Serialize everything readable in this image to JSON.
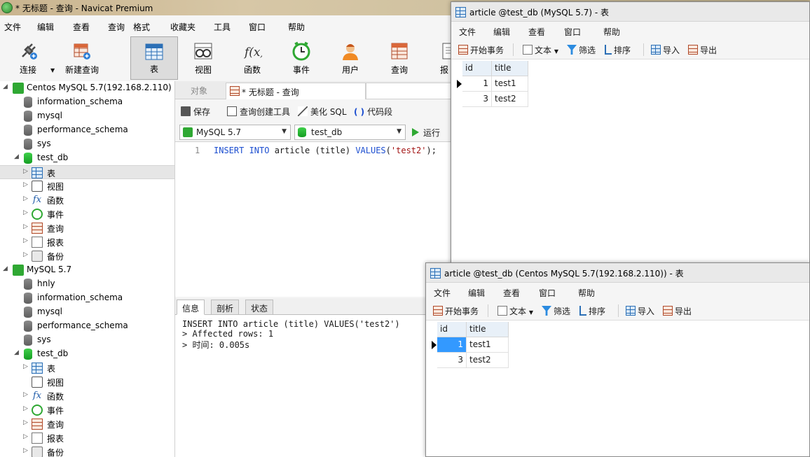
{
  "main": {
    "title": "* 无标题 - 查询 - Navicat Premium",
    "menu": [
      "文件",
      "编辑",
      "查看",
      "查询",
      "格式",
      "收藏夹",
      "工具",
      "窗口",
      "帮助"
    ],
    "toolbar": [
      {
        "label": "连接",
        "icon": "plug-icon"
      },
      {
        "label": "新建查询",
        "icon": "new-query-icon"
      },
      {
        "label": "表",
        "icon": "table-icon"
      },
      {
        "label": "视图",
        "icon": "view-icon"
      },
      {
        "label": "函数",
        "icon": "function-icon"
      },
      {
        "label": "事件",
        "icon": "clock-icon"
      },
      {
        "label": "用户",
        "icon": "user-icon"
      },
      {
        "label": "查询",
        "icon": "query-icon"
      },
      {
        "label": "报",
        "icon": "report-icon"
      }
    ]
  },
  "tree": {
    "conn1": {
      "name": "Centos MySQL 5.7(192.168.2.110)",
      "dbs": [
        "information_schema",
        "mysql",
        "performance_schema",
        "sys",
        "test_db"
      ],
      "children": [
        "表",
        "视图",
        "函数",
        "事件",
        "查询",
        "报表",
        "备份"
      ]
    },
    "conn2": {
      "name": "MySQL 5.7",
      "dbs": [
        "hnly",
        "information_schema",
        "mysql",
        "performance_schema",
        "sys",
        "test_db"
      ],
      "children": [
        "表",
        "视图",
        "函数",
        "事件",
        "查询",
        "报表",
        "备份"
      ]
    }
  },
  "tabs": {
    "objects": "对象",
    "query": "* 无标题 - 查询"
  },
  "query_toolbar": {
    "save": "保存",
    "builder": "查询创建工具",
    "beautify": "美化 SQL",
    "snippet": "代码段",
    "connection": "MySQL 5.7",
    "database": "test_db",
    "run": "运行"
  },
  "editor": {
    "line_number": "1",
    "kw1": "INSERT INTO",
    "mid": " article (title) ",
    "kw2": "VALUES",
    "open": "(",
    "str": "'test2'",
    "close": ");"
  },
  "result_tabs": [
    "信息",
    "剖析",
    "状态"
  ],
  "result_lines": [
    "INSERT INTO article (title) VALUES('test2')",
    "> Affected rows: 1",
    "> 时间: 0.005s"
  ],
  "win1": {
    "title": "article @test_db (MySQL 5.7) - 表",
    "menu": [
      "文件",
      "编辑",
      "查看",
      "窗口",
      "帮助"
    ],
    "tools": {
      "begin": "开始事务",
      "text": "文本",
      "filter": "筛选",
      "sort": "排序",
      "import": "导入",
      "export": "导出"
    },
    "columns": [
      "id",
      "title"
    ],
    "rows": [
      [
        "1",
        "test1"
      ],
      [
        "3",
        "test2"
      ]
    ]
  },
  "win2": {
    "title": "article @test_db (Centos MySQL 5.7(192.168.2.110)) - 表",
    "menu": [
      "文件",
      "编辑",
      "查看",
      "窗口",
      "帮助"
    ],
    "tools": {
      "begin": "开始事务",
      "text": "文本",
      "filter": "筛选",
      "sort": "排序",
      "import": "导入",
      "export": "导出"
    },
    "columns": [
      "id",
      "title"
    ],
    "rows": [
      [
        "1",
        "test1"
      ],
      [
        "3",
        "test2"
      ]
    ]
  }
}
